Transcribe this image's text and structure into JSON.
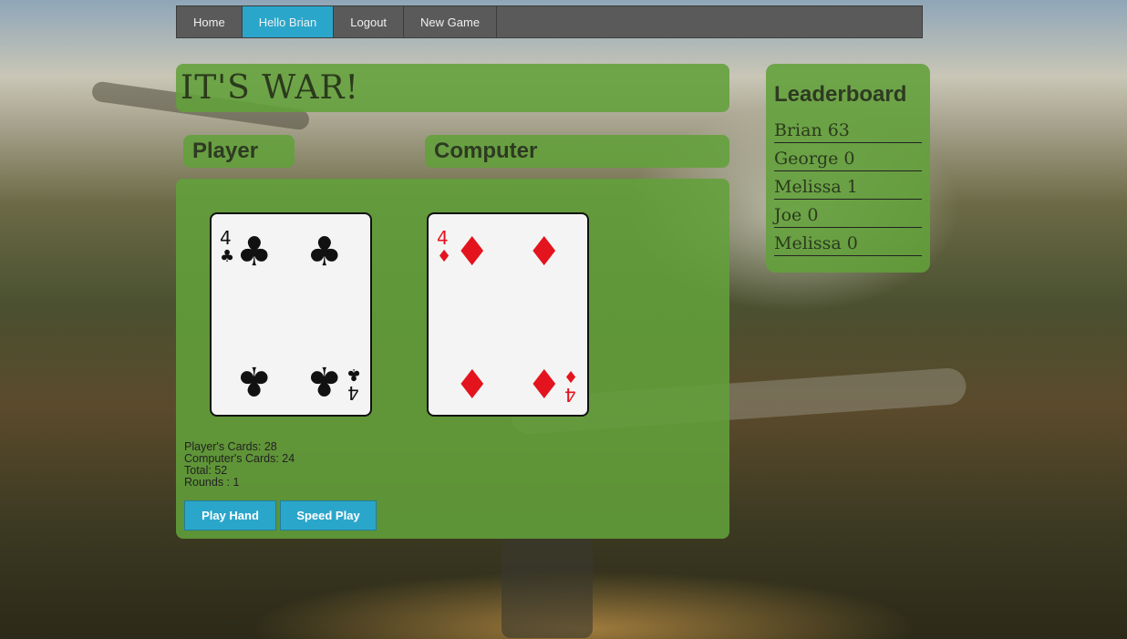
{
  "nav": {
    "items": [
      {
        "label": "Home",
        "active": false
      },
      {
        "label": "Hello Brian",
        "active": true
      },
      {
        "label": "Logout",
        "active": false
      },
      {
        "label": "New Game",
        "active": false
      }
    ]
  },
  "title": "IT'S WAR!",
  "player_label": "Player",
  "computer_label": "Computer",
  "player_card": {
    "rank": "4",
    "suit": "♣",
    "color": "black"
  },
  "computer_card": {
    "rank": "4",
    "suit": "♦",
    "color": "red"
  },
  "stats": {
    "player_cards": "Player's Cards: 28",
    "computer_cards": "Computer's Cards: 24",
    "total": "Total: 52",
    "rounds": "Rounds : 1"
  },
  "buttons": {
    "play_hand": "Play Hand",
    "speed_play": "Speed Play"
  },
  "leaderboard": {
    "title": "Leaderboard",
    "entries": [
      {
        "name": "Brian",
        "score": "63"
      },
      {
        "name": "George",
        "score": "0"
      },
      {
        "name": "Melissa",
        "score": "1"
      },
      {
        "name": "Joe",
        "score": "0"
      },
      {
        "name": "Melissa",
        "score": "0"
      }
    ]
  },
  "colors": {
    "panel_green": "#62a03a",
    "accent_blue": "#2ba6cb",
    "nav_gray": "#5a5a5a",
    "card_red": "#e3141e"
  }
}
